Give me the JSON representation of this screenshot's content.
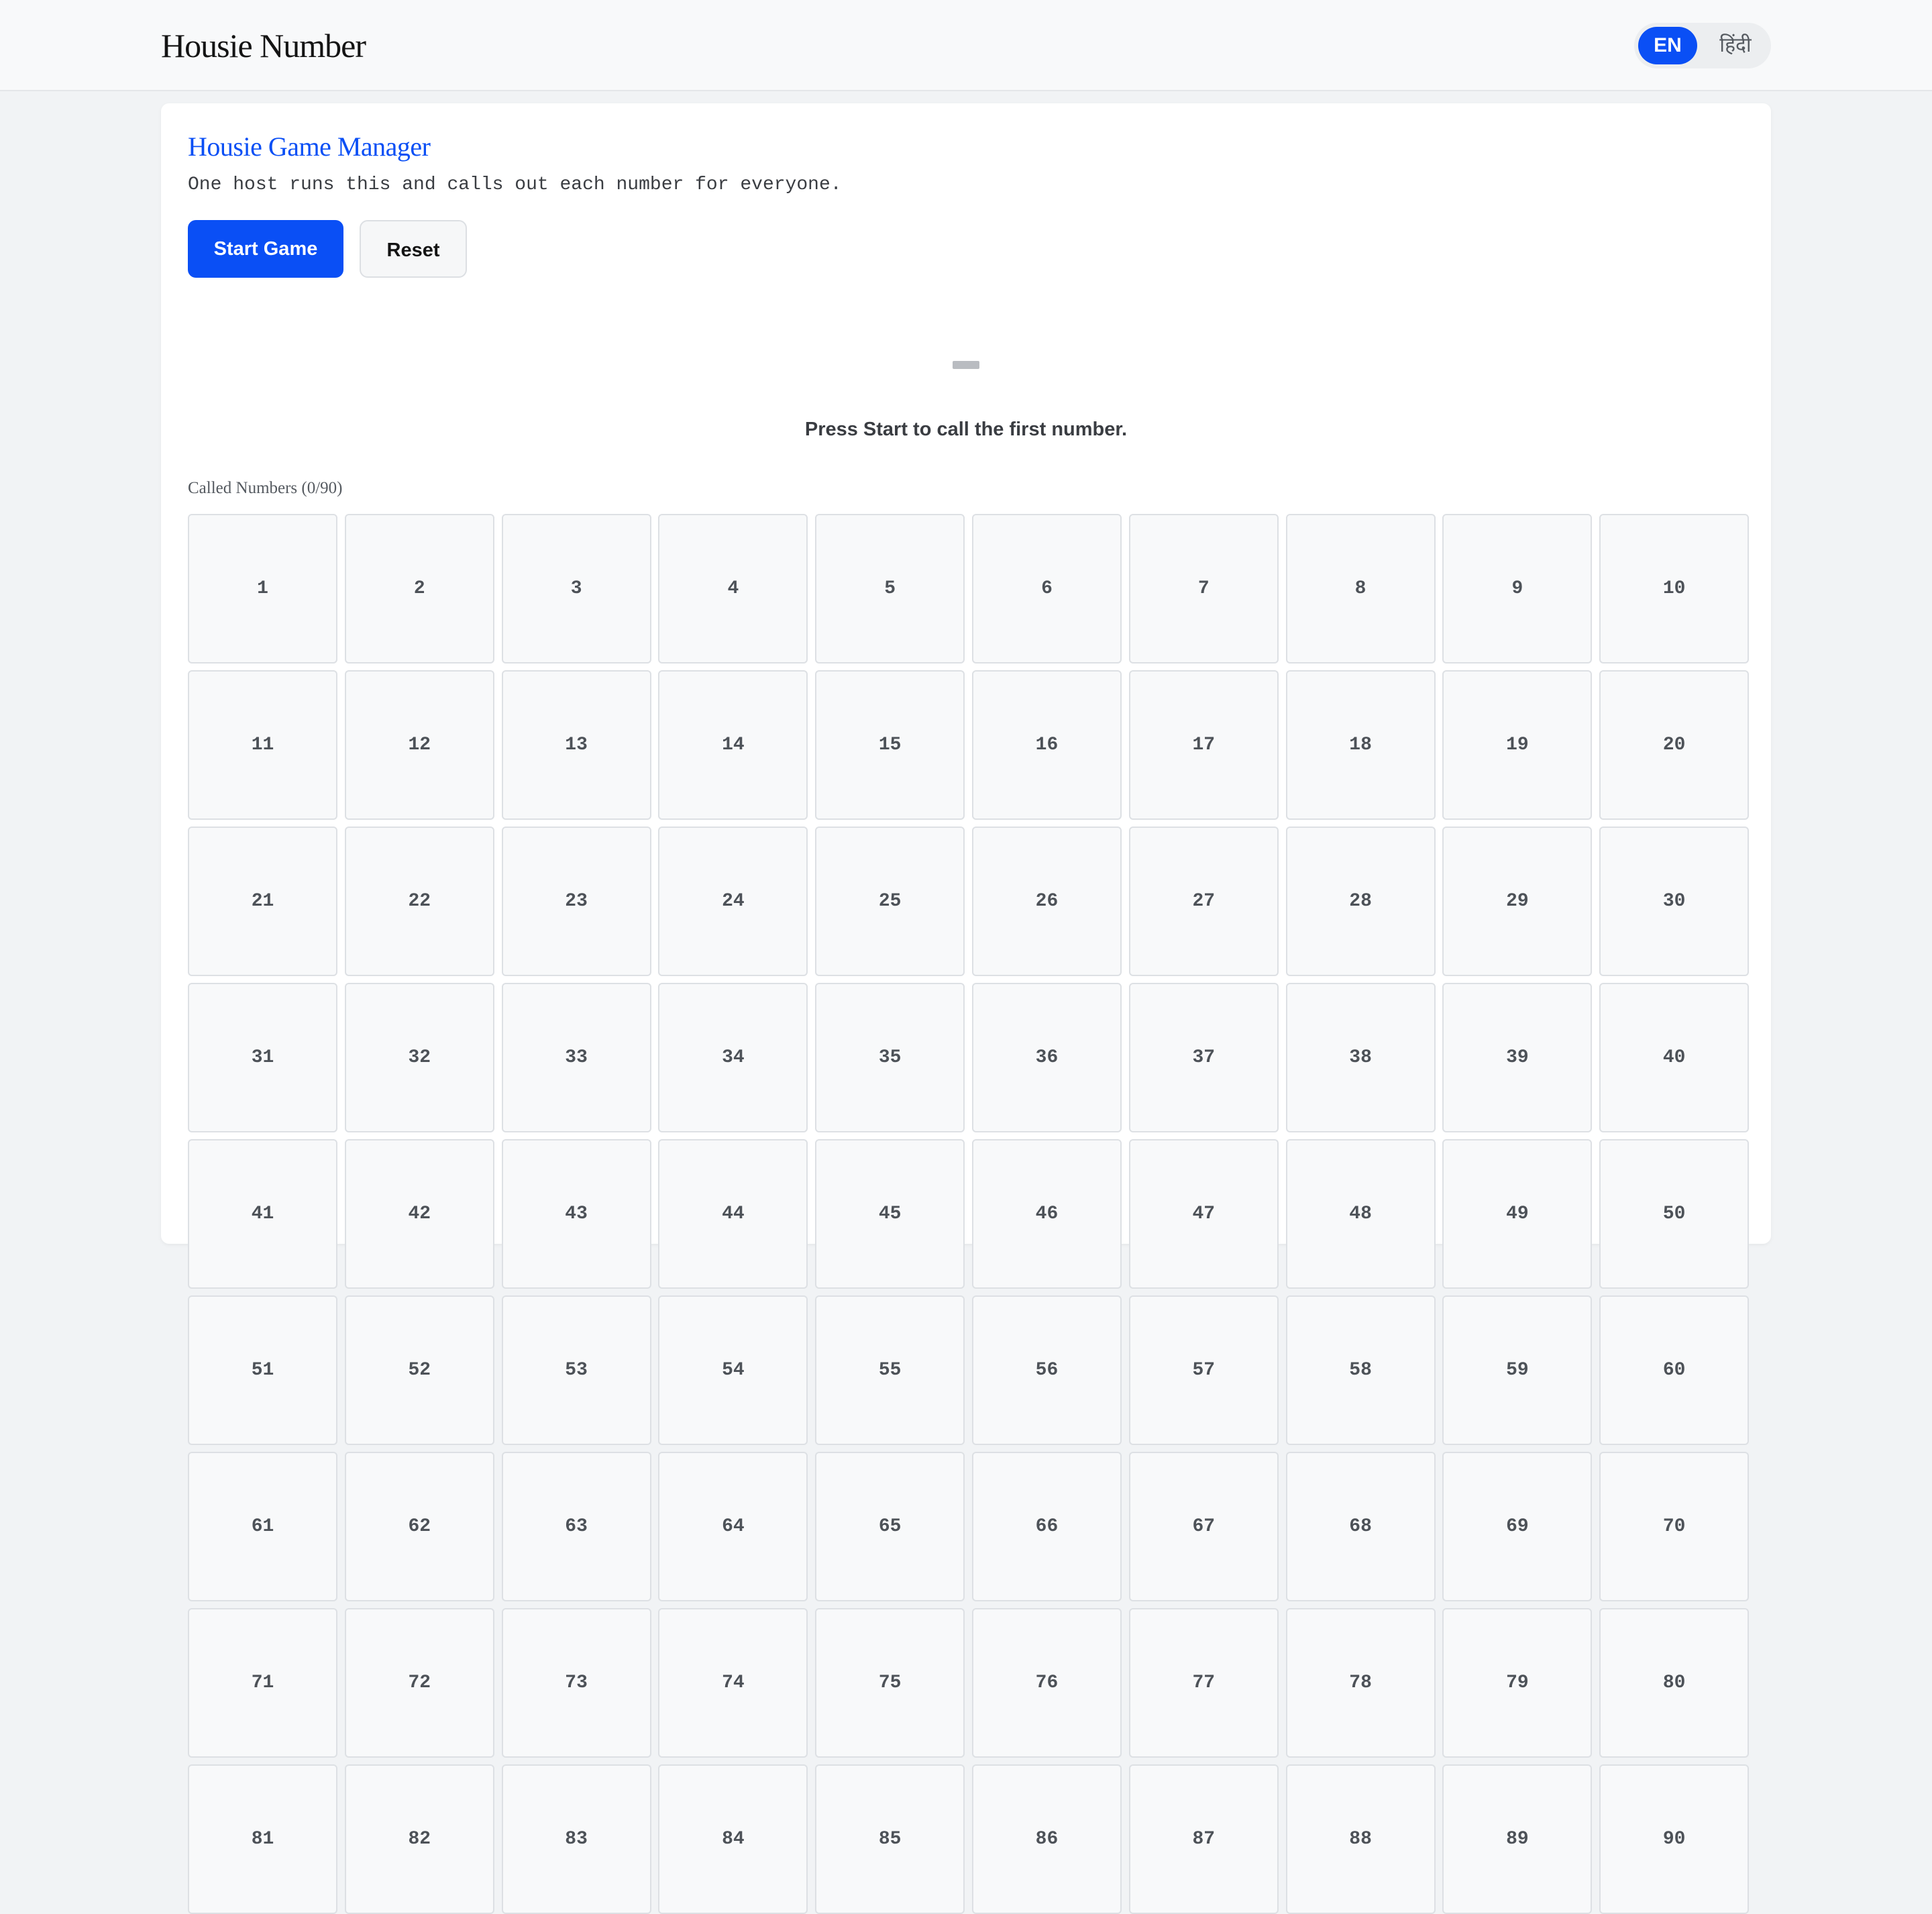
{
  "header": {
    "brand": "Housie Number",
    "languages": [
      "EN",
      "हिंदी"
    ],
    "active_language": "EN"
  },
  "manager": {
    "title": "Housie Game Manager",
    "subtitle": "One host runs this and calls out each number for everyone.",
    "start_label": "Start Game",
    "reset_label": "Reset",
    "current_number": "",
    "status": "Press Start to call the first number.",
    "called_label": "Called Numbers (0/90)",
    "called_count": 0,
    "total_numbers": 90
  },
  "board": {
    "numbers": [
      "1",
      "2",
      "3",
      "4",
      "5",
      "6",
      "7",
      "8",
      "9",
      "10",
      "11",
      "12",
      "13",
      "14",
      "15",
      "16",
      "17",
      "18",
      "19",
      "20",
      "21",
      "22",
      "23",
      "24",
      "25",
      "26",
      "27",
      "28",
      "29",
      "30",
      "31",
      "32",
      "33",
      "34",
      "35",
      "36",
      "37",
      "38",
      "39",
      "40",
      "41",
      "42",
      "43",
      "44",
      "45",
      "46",
      "47",
      "48",
      "49",
      "50",
      "51",
      "52",
      "53",
      "54",
      "55",
      "56",
      "57",
      "58",
      "59",
      "60",
      "61",
      "62",
      "63",
      "64",
      "65",
      "66",
      "67",
      "68",
      "69",
      "70",
      "71",
      "72",
      "73",
      "74",
      "75",
      "76",
      "77",
      "78",
      "79",
      "80",
      "81",
      "82",
      "83",
      "84",
      "85",
      "86",
      "87",
      "88",
      "89",
      "90"
    ]
  },
  "colors": {
    "accent": "#0a4ff5",
    "page_background": "#f1f3f5",
    "cell_background": "#f8f9fa"
  }
}
